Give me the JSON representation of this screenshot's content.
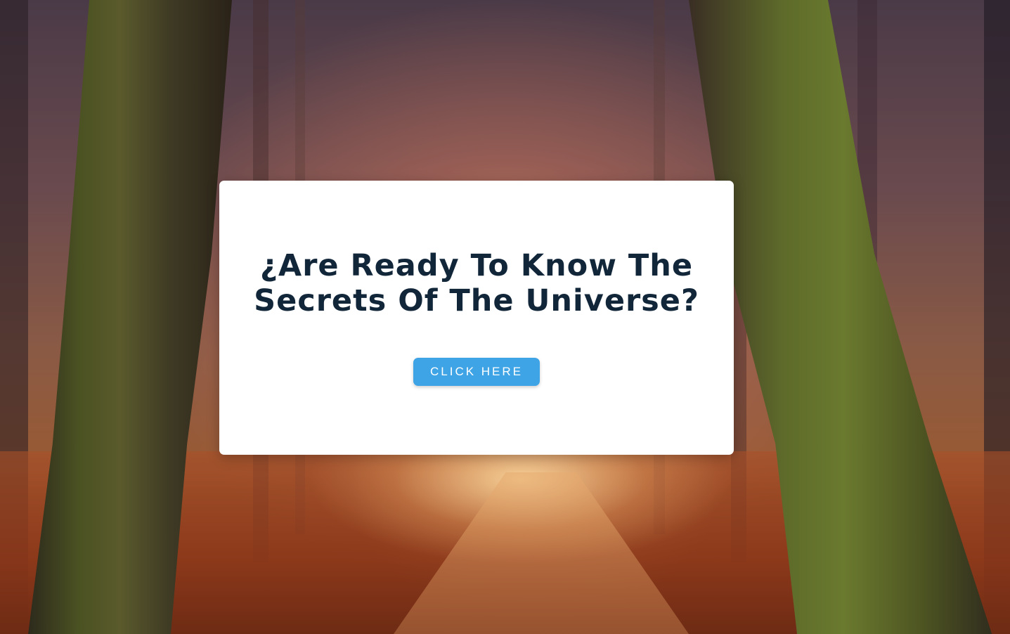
{
  "modal": {
    "headline_line1": "¿Are Ready To Know The",
    "headline_line2": "Secrets Of The Universe?",
    "button_label": "CLICK HERE"
  },
  "colors": {
    "headline": "#12263a",
    "button": "#3fa4e5",
    "card": "#ffffff"
  },
  "background": {
    "description_icon": "forest-path-image"
  }
}
